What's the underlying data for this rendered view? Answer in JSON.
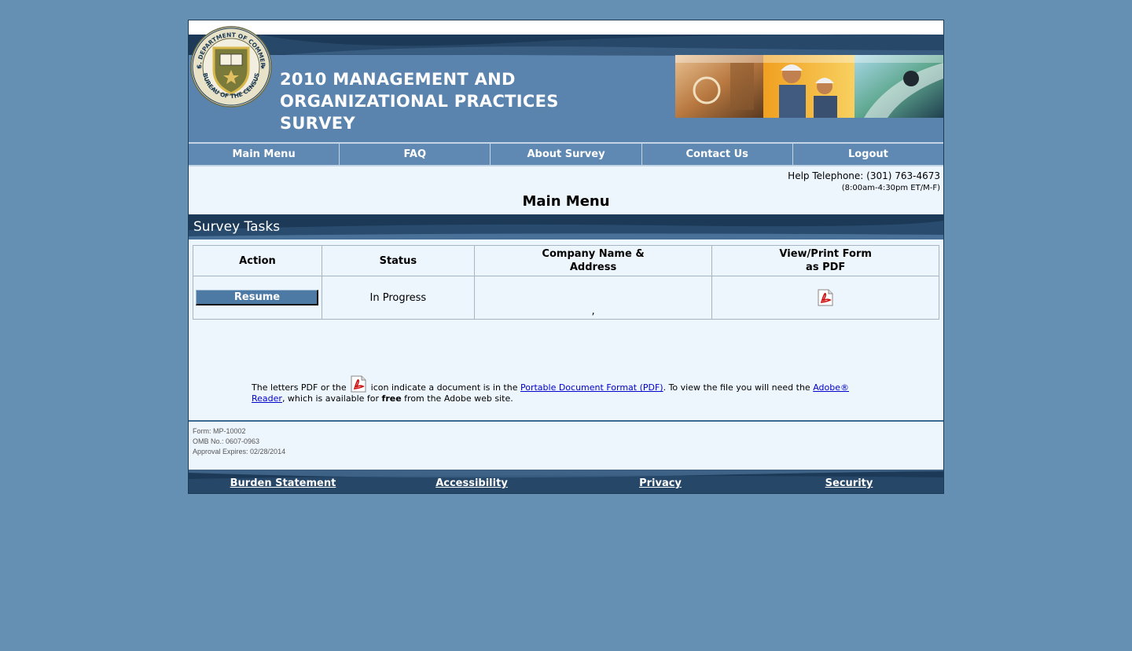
{
  "header": {
    "title": "2010 MANAGEMENT AND ORGANIZATIONAL PRACTICES SURVEY",
    "seal_text_top": "U.S. DEPARTMENT OF COMMERCE",
    "seal_text_bottom": "BUREAU OF THE CENSUS"
  },
  "nav": {
    "items": [
      {
        "label": "Main Menu"
      },
      {
        "label": "FAQ"
      },
      {
        "label": "About Survey"
      },
      {
        "label": "Contact Us"
      },
      {
        "label": "Logout"
      }
    ]
  },
  "help": {
    "phone": "Help Telephone: (301) 763-4673",
    "hours": "(8:00am-4:30pm ET/M-F)"
  },
  "page_title": "Main Menu",
  "section_title": "Survey Tasks",
  "table": {
    "headers": {
      "action": "Action",
      "status": "Status",
      "company_line1": "Company Name &",
      "company_line2": "Address",
      "pdf_line1": "View/Print Form",
      "pdf_line2": "as PDF"
    },
    "rows": [
      {
        "action_label": "Resume",
        "status": "In Progress",
        "company": ","
      }
    ]
  },
  "pdf_note": {
    "text1": "The letters PDF or the",
    "text2": "icon indicate a document is in the",
    "link_pdf": "Portable Document Format (PDF)",
    "text3": ". To view the file you will need the",
    "link_reader": "Adobe® Reader",
    "text4": ", which is available for",
    "bold_free": "free",
    "text5": "from the Adobe web site."
  },
  "form_info": {
    "form": "Form: MP-10002",
    "omb": "OMB No.: 0607-0963",
    "expires": "Approval Expires: 02/28/2014"
  },
  "footer": {
    "links": [
      {
        "label": "Burden Statement"
      },
      {
        "label": "Accessibility"
      },
      {
        "label": "Privacy"
      },
      {
        "label": "Security"
      }
    ]
  },
  "colors": {
    "background": "#6690b3",
    "header_blue": "#5a84ad",
    "dark_navy": "#1c3a58",
    "content_bg": "#eef6fd",
    "button_blue": "#4d7aa5"
  }
}
